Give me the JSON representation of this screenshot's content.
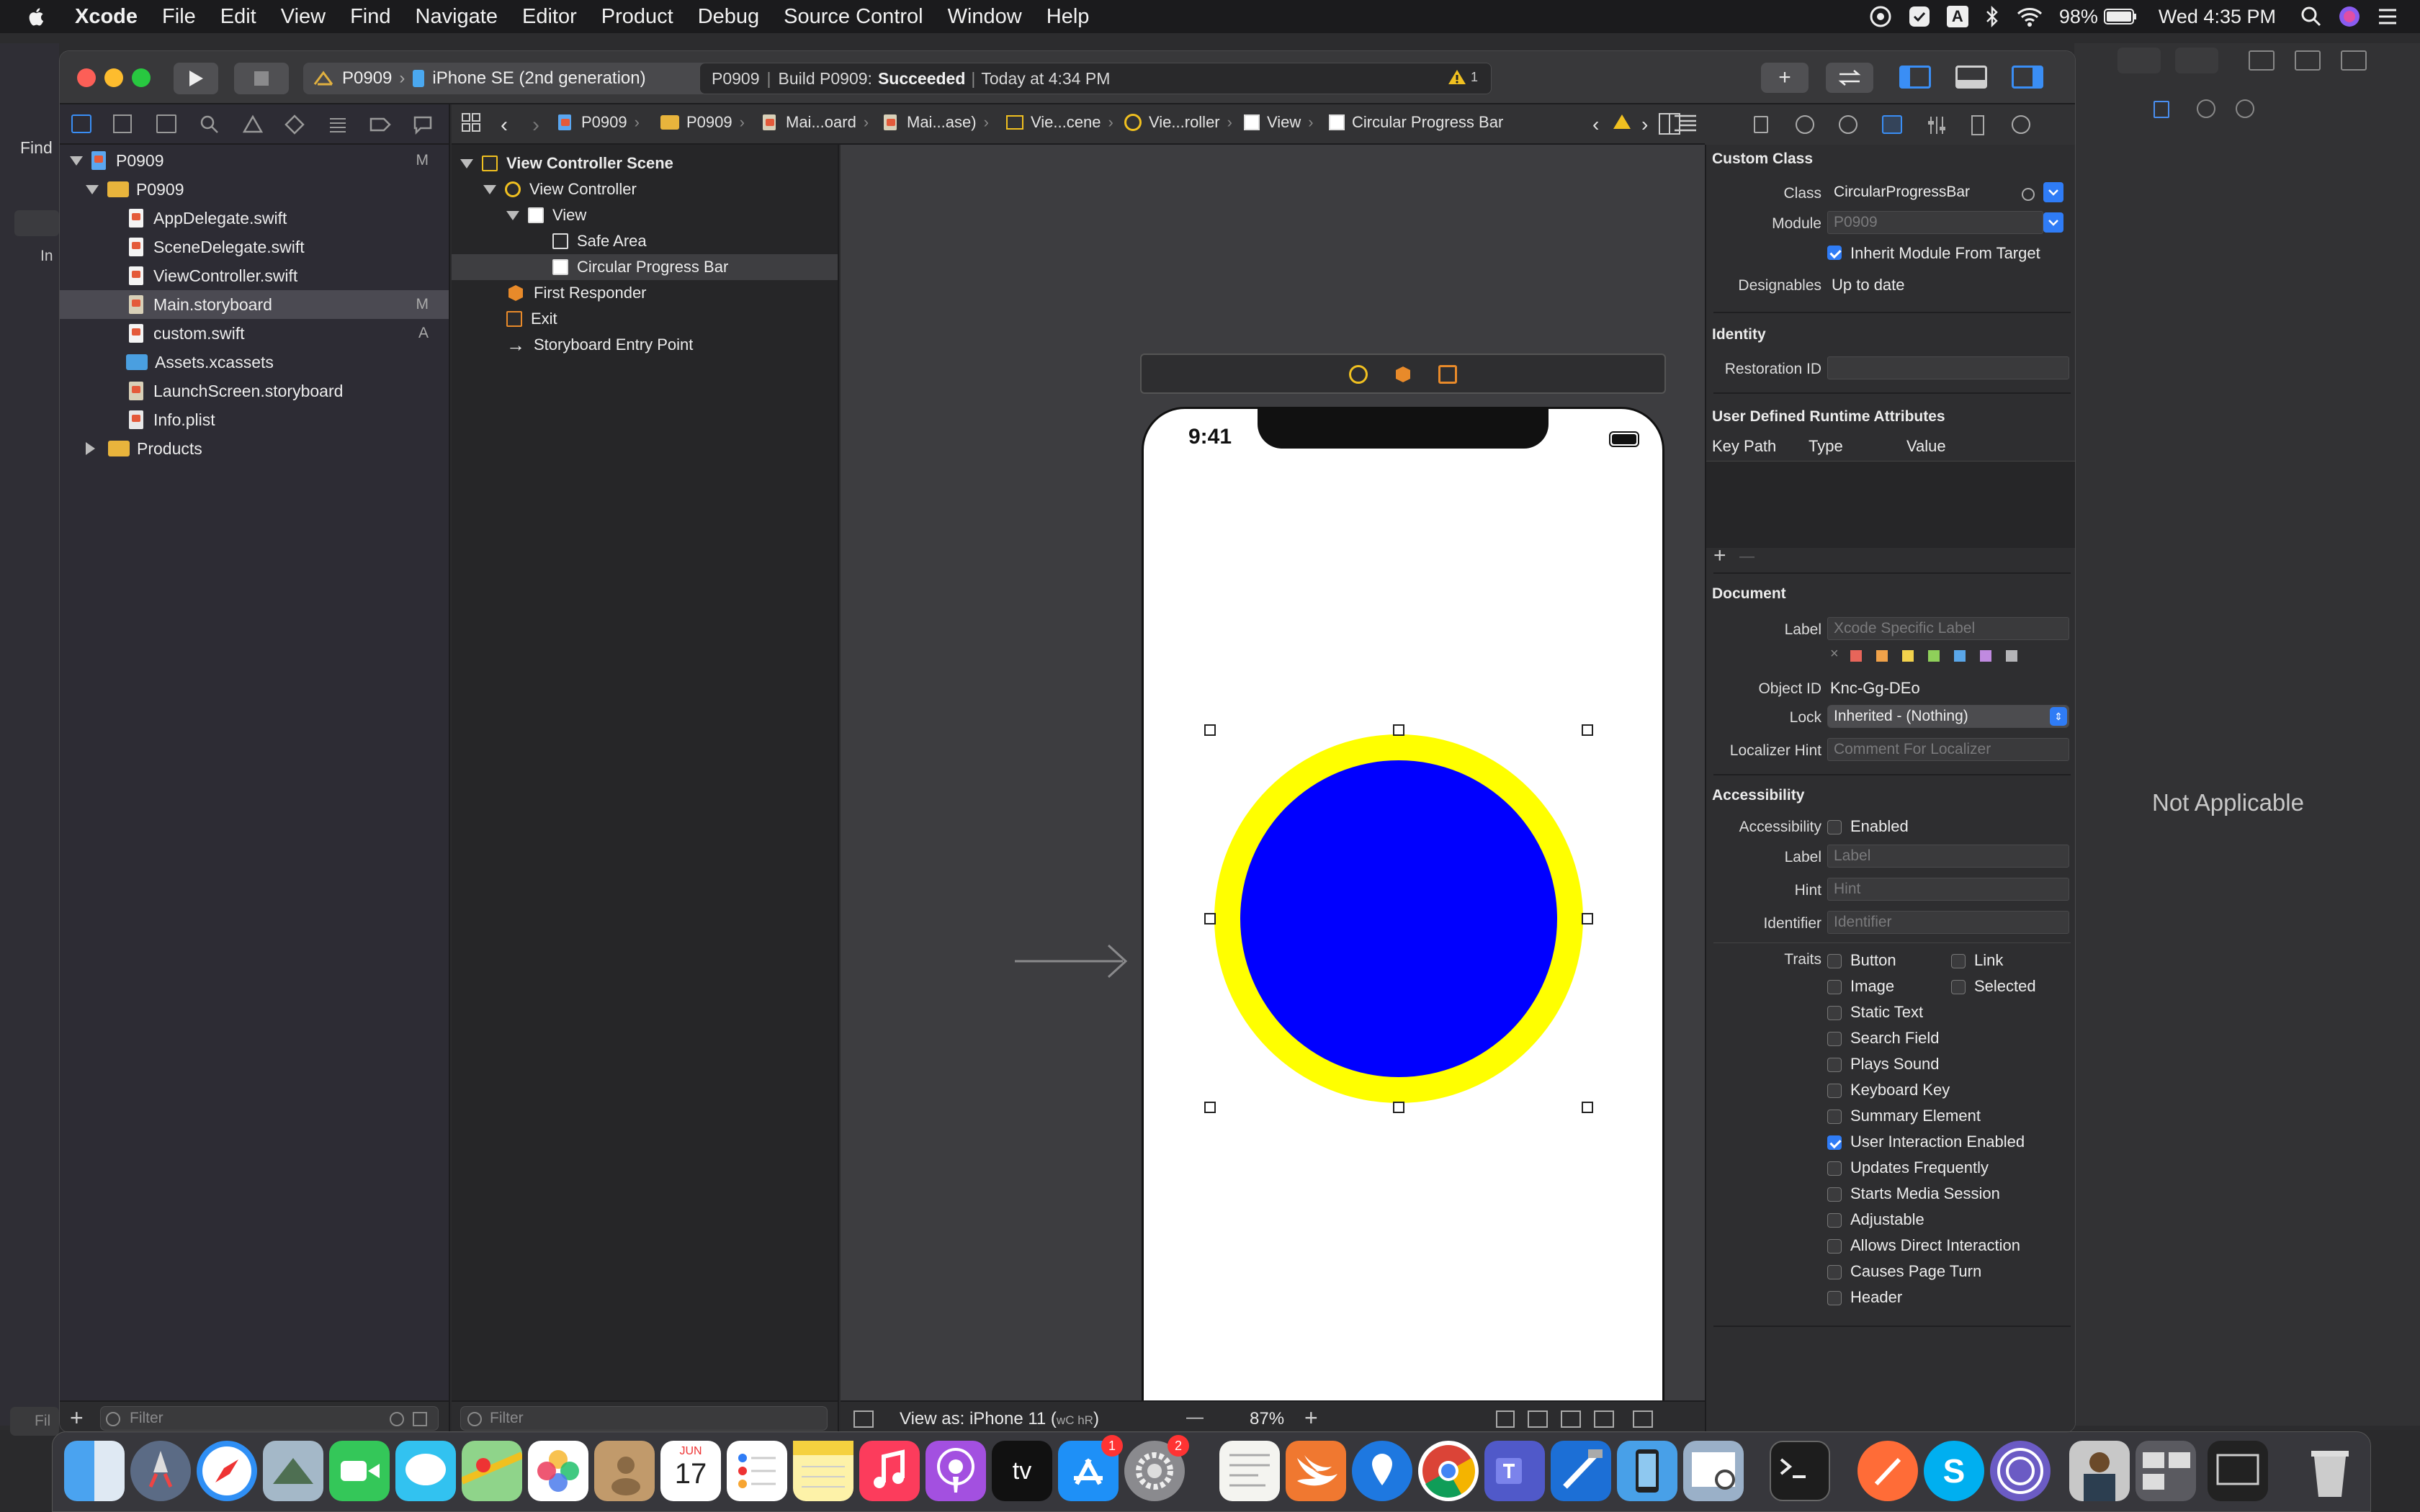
{
  "menubar": {
    "apple": "",
    "items": [
      "Xcode",
      "File",
      "Edit",
      "View",
      "Find",
      "Navigate",
      "Editor",
      "Product",
      "Debug",
      "Source Control",
      "Window",
      "Help"
    ],
    "battery": "98%",
    "clock": "Wed 4:35 PM",
    "input_letter": "A"
  },
  "toolbar": {
    "scheme_project": "P0909",
    "scheme_device": "iPhone SE (2nd generation)",
    "status_project": "P0909",
    "status_build": "Build P0909:",
    "status_result": "Succeeded",
    "status_time": "Today at 4:34 PM",
    "warning_count": "1",
    "add_label": "+"
  },
  "background_window": {
    "find_label": "Find",
    "in_label": "In",
    "not_applicable": "Not Applicable",
    "filter_label": "Fil"
  },
  "navigator": {
    "files": [
      {
        "name": "P0909",
        "badge": "M"
      },
      {
        "name": "P0909",
        "badge": ""
      },
      {
        "name": "AppDelegate.swift",
        "badge": ""
      },
      {
        "name": "SceneDelegate.swift",
        "badge": ""
      },
      {
        "name": "ViewController.swift",
        "badge": ""
      },
      {
        "name": "Main.storyboard",
        "badge": "M"
      },
      {
        "name": "custom.swift",
        "badge": "A"
      },
      {
        "name": "Assets.xcassets",
        "badge": ""
      },
      {
        "name": "LaunchScreen.storyboard",
        "badge": ""
      },
      {
        "name": "Info.plist",
        "badge": ""
      },
      {
        "name": "Products",
        "badge": ""
      }
    ],
    "filter_placeholder": "Filter"
  },
  "outline": {
    "items": [
      "View Controller Scene",
      "View Controller",
      "View",
      "Safe Area",
      "Circular Progress Bar",
      "First Responder",
      "Exit",
      "Storyboard Entry Point"
    ],
    "filter_placeholder": "Filter"
  },
  "jumpbar": {
    "crumbs": [
      "P0909",
      "P0909",
      "Mai...oard",
      "Mai...ase)",
      "Vie...cene",
      "Vie...roller",
      "View",
      "Circular Progress Bar"
    ]
  },
  "canvas": {
    "device_time": "9:41",
    "view_as": "View as: iPhone 11 (",
    "view_as_traits": "wC hR",
    "view_as_end": ")",
    "zoom": "87%",
    "zoom_minus": "—",
    "zoom_plus": "+",
    "ring_color": "#ffff00",
    "fill_color": "#0000ff"
  },
  "inspector": {
    "custom_class_header": "Custom Class",
    "class_label": "Class",
    "class_value": "CircularProgressBar",
    "module_label": "Module",
    "module_value": "P0909",
    "inherit_module": "Inherit Module From Target",
    "designables_label": "Designables",
    "designables_value": "Up to date",
    "identity_header": "Identity",
    "restoration_label": "Restoration ID",
    "udra_header": "User Defined Runtime Attributes",
    "col_key": "Key Path",
    "col_type": "Type",
    "col_value": "Value",
    "plus": "+",
    "minus": "—",
    "document_header": "Document",
    "label_label": "Label",
    "label_placeholder": "Xcode Specific Label",
    "color_x": "×",
    "swatch_colors": [
      "#e8655a",
      "#f0a24a",
      "#f2d24c",
      "#8fd05a",
      "#5aa6e8",
      "#c08ae0",
      "#b5b5b8"
    ],
    "object_id_label": "Object ID",
    "object_id_value": "Knc-Gg-DEo",
    "lock_label": "Lock",
    "lock_value": "Inherited - (Nothing)",
    "localizer_label": "Localizer Hint",
    "localizer_placeholder": "Comment For Localizer",
    "accessibility_header": "Accessibility",
    "acc_label": "Accessibility",
    "acc_enabled": "Enabled",
    "acc_label_label": "Label",
    "acc_label_placeholder": "Label",
    "hint_label": "Hint",
    "hint_placeholder": "Hint",
    "identifier_label": "Identifier",
    "identifier_placeholder": "Identifier",
    "traits_label": "Traits",
    "traits": [
      {
        "name": "Button",
        "checked": false
      },
      {
        "name": "Link",
        "checked": false
      },
      {
        "name": "Image",
        "checked": false
      },
      {
        "name": "Selected",
        "checked": false
      },
      {
        "name": "Static Text",
        "checked": false
      },
      {
        "name": "Search Field",
        "checked": false
      },
      {
        "name": "Plays Sound",
        "checked": false
      },
      {
        "name": "Keyboard Key",
        "checked": false
      },
      {
        "name": "Summary Element",
        "checked": false
      },
      {
        "name": "User Interaction Enabled",
        "checked": true
      },
      {
        "name": "Updates Frequently",
        "checked": false
      },
      {
        "name": "Starts Media Session",
        "checked": false
      },
      {
        "name": "Adjustable",
        "checked": false
      },
      {
        "name": "Allows Direct Interaction",
        "checked": false
      },
      {
        "name": "Causes Page Turn",
        "checked": false
      },
      {
        "name": "Header",
        "checked": false
      }
    ]
  },
  "dock": {
    "apps": [
      "finder",
      "launchpad",
      "safari",
      "mail-stamp",
      "facetime",
      "messages",
      "maps",
      "photos",
      "contacts",
      "calendar",
      "reminders",
      "notes",
      "music",
      "podcasts",
      "tv",
      "app-store",
      "system-preferences",
      "textedit",
      "swift-playgrounds",
      "location",
      "chrome",
      "teams",
      "xcode",
      "simulator",
      "preview",
      "terminal",
      "postman",
      "skype",
      "network",
      "profile",
      "mission-control",
      "screenshot",
      "trash"
    ],
    "appstore_badge": "1",
    "sysprefs_badge": "2",
    "calendar_month": "JUN",
    "calendar_day": "17",
    "tv_label": "tv"
  }
}
